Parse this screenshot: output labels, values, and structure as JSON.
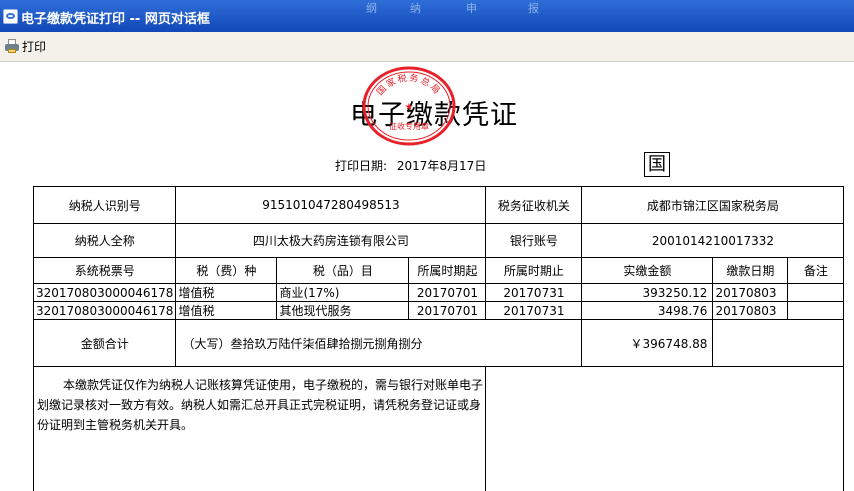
{
  "window": {
    "title": "电子缴款凭证打印  --  网页对话框",
    "background_chars": [
      "纲",
      "纳",
      "申",
      "报"
    ]
  },
  "toolbar": {
    "print_label": "打印"
  },
  "seal": {
    "text": "国家税务总局",
    "sub_text": "征收专用章",
    "color": "#e8202a"
  },
  "document": {
    "title": "电子缴款凭证",
    "print_date_label": "打印日期:",
    "print_date": "2017年8月17日",
    "country_mark": "国"
  },
  "table": {
    "taxpayer_id_label": "纳税人识别号",
    "taxpayer_id": "915101047280498513",
    "tax_office_label": "税务征收机关",
    "tax_office": "成都市锦江区国家税务局",
    "taxpayer_name_label": "纳税人全称",
    "taxpayer_name": "四川太极大药房连锁有限公司",
    "bank_account_label": "银行账号",
    "bank_account": "2001014210017332",
    "columns": [
      "系统税票号",
      "税（费）种",
      "税（品）目",
      "所属时期起",
      "所属时期止",
      "实缴金额",
      "缴款日期",
      "备注"
    ],
    "rows": [
      {
        "ticket": "320170803000046178",
        "tax_type": "增值税",
        "item": "商业(17%)",
        "period_start": "20170701",
        "period_end": "20170731",
        "amount": "393250.12",
        "pay_date": "20170803",
        "remark": ""
      },
      {
        "ticket": "320170803000046178",
        "tax_type": "增值税",
        "item": "其他现代服务",
        "period_start": "20170701",
        "period_end": "20170731",
        "amount": "3498.76",
        "pay_date": "20170803",
        "remark": ""
      }
    ],
    "total_label": "金额合计",
    "total_in_words": "（大写）叁拾玖万陆仟柒佰肆拾捌元捌角捌分",
    "total_amount": "￥396748.88",
    "notes": "本缴款凭证仅作为纳税人记账核算凭证使用，电子缴税的，需与银行对账单电子划缴记录核对一致方有效。纳税人如需汇总开具正式完税证明，请凭税务登记证或身份证明到主管税务机关开具。"
  }
}
